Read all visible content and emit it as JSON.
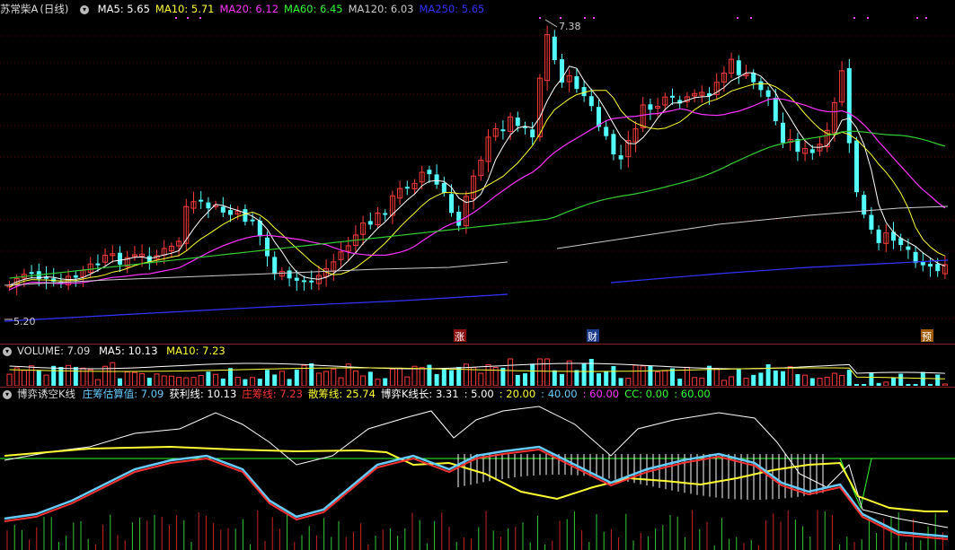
{
  "price_panel": {
    "stock_name": "苏常柴A",
    "period": "(日线)",
    "ma_labels": [
      {
        "text": "MA5: 5.65",
        "color": "#ffffff"
      },
      {
        "text": "MA10: 5.71",
        "color": "#ffff33"
      },
      {
        "text": "MA20: 6.12",
        "color": "#ff33ff"
      },
      {
        "text": "MA60: 6.45",
        "color": "#33ff33"
      },
      {
        "text": "MA120: 6.03",
        "color": "#cccccc"
      },
      {
        "text": "MA250: 5.65",
        "color": "#3333ff"
      }
    ],
    "high_marker": "7.38",
    "low_marker": "5.20",
    "event_tags": [
      "涨",
      "财",
      "预"
    ],
    "colors": {
      "up": "#ff3b3b",
      "down": "#54ffff",
      "grid": "#5a0000",
      "tag_bg": "#8a1010",
      "tag_bg_alt": "#1a3a8a",
      "tag_bg_yellow": "#a05a00"
    }
  },
  "volume_panel": {
    "title": "VOLUME: 7.09",
    "ma5": "MA5: 10.13",
    "ma10": "MA10: 7.23"
  },
  "indicator_panel": {
    "title": "博弈诱空K线",
    "items": [
      {
        "text": "庄筹估算值: 7.09",
        "color": "#66ccff"
      },
      {
        "text": "获利线: 10.13",
        "color": "#ffffff"
      },
      {
        "text": "庄筹线: 7.23",
        "color": "#ff3333"
      },
      {
        "text": "散筹线: 25.74",
        "color": "#ffff33"
      },
      {
        "text": "博弈K线长: 3.31",
        "color": "#ffffff"
      },
      {
        "text": ": 5.00",
        "color": "#ffffff"
      },
      {
        "text": ": 20.00",
        "color": "#ffff33"
      },
      {
        "text": ": 40.00",
        "color": "#66ccff"
      },
      {
        "text": ": 60.00",
        "color": "#ff33ff"
      },
      {
        "text": "CC: 0.00",
        "color": "#33ff33"
      },
      {
        "text": ": 60.00",
        "color": "#33ff33"
      }
    ]
  }
}
